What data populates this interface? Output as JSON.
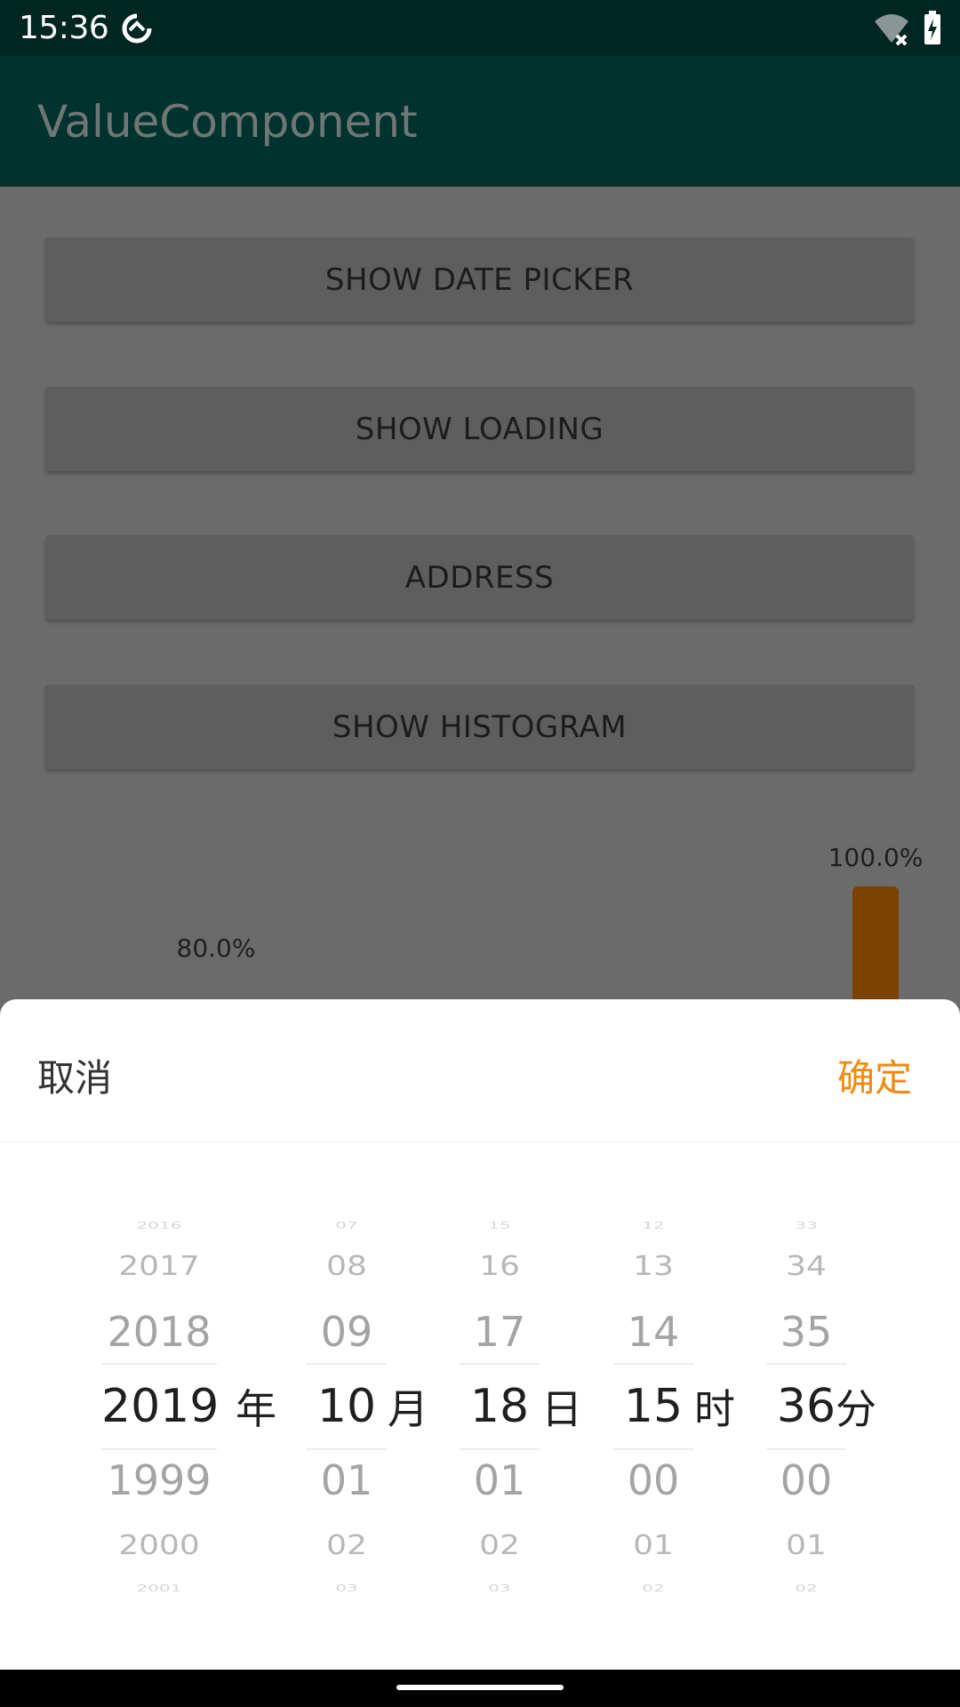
{
  "status_bar": {
    "time": "15:36",
    "icons": [
      "sync-icon",
      "wifi-icon",
      "battery-charging-icon"
    ]
  },
  "app_bar": {
    "title": "ValueComponent"
  },
  "buttons": {
    "date_picker": "SHOW DATE PICKER",
    "loading": "SHOW LOADING",
    "address": "ADDRESS",
    "histogram": "SHOW HISTOGRAM"
  },
  "histogram": {
    "bars": [
      {
        "label": "80.0%",
        "value": 0.8
      },
      {
        "label": "100.0%",
        "value": 1.0
      }
    ],
    "bar_color": "#7a4300"
  },
  "picker": {
    "cancel_label": "取消",
    "confirm_label": "确定",
    "confirm_color": "#f08a10",
    "columns": [
      {
        "unit": "年",
        "items": [
          "2016",
          "2017",
          "2018",
          "2019",
          "1999",
          "2000",
          "2001"
        ]
      },
      {
        "unit": "月",
        "items": [
          "07",
          "08",
          "09",
          "10",
          "01",
          "02",
          "03"
        ]
      },
      {
        "unit": "日",
        "items": [
          "15",
          "16",
          "17",
          "18",
          "01",
          "02",
          "03"
        ]
      },
      {
        "unit": "时",
        "items": [
          "12",
          "13",
          "14",
          "15",
          "00",
          "01",
          "02"
        ]
      },
      {
        "unit": "分",
        "items": [
          "33",
          "34",
          "35",
          "36",
          "00",
          "01",
          "02"
        ]
      }
    ]
  }
}
